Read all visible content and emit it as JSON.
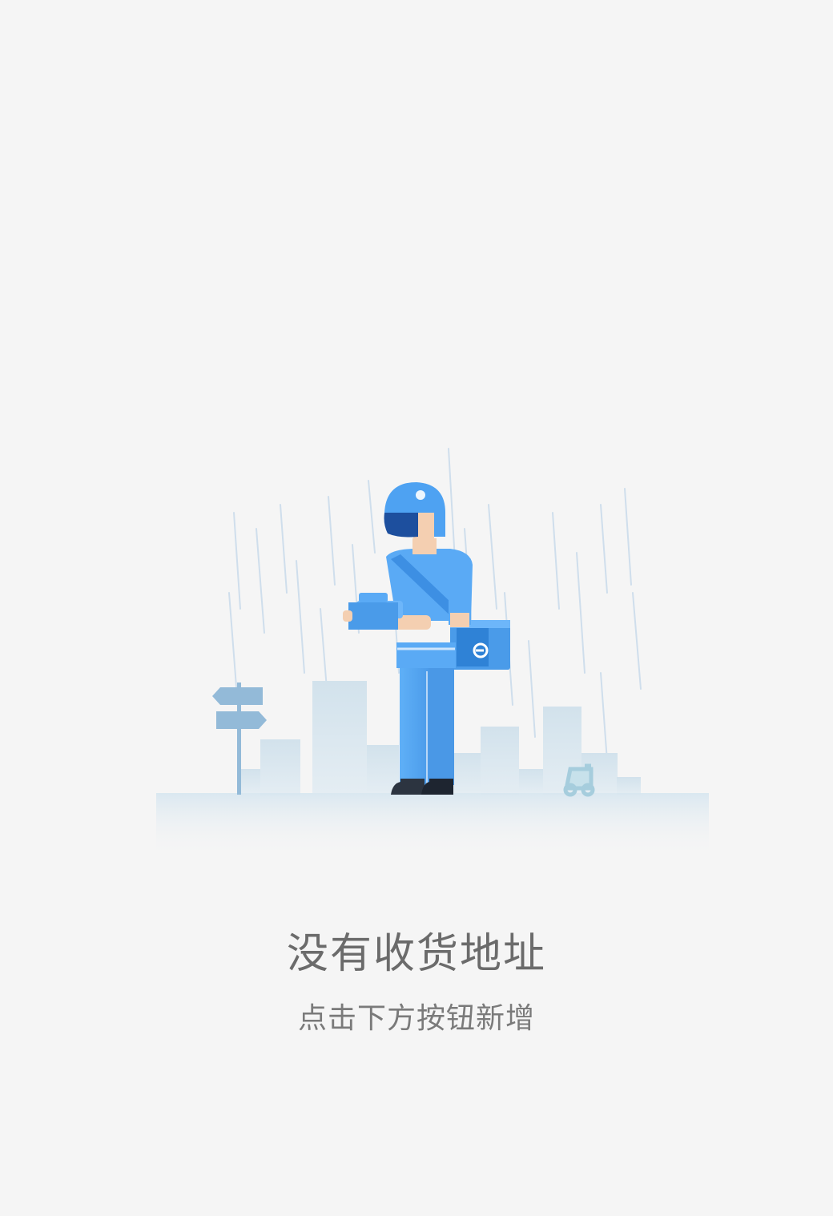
{
  "empty_state": {
    "title": "没有收货地址",
    "subtitle": "点击下方按钮新增",
    "illustration": {
      "icon": "delivery-rider-in-rain-illustration",
      "box_logo_glyph": "e",
      "colors": {
        "primary_blue": "#5aaaf5",
        "helmet_blue": "#4a9cf0",
        "visor_navy": "#1d4f9e",
        "skin": "#f4cfb1",
        "rain": "#c7d9ea",
        "buildings": "#d7e5ee",
        "sign": "#8fb6d8",
        "scooter": "#a9d0e0"
      }
    }
  }
}
